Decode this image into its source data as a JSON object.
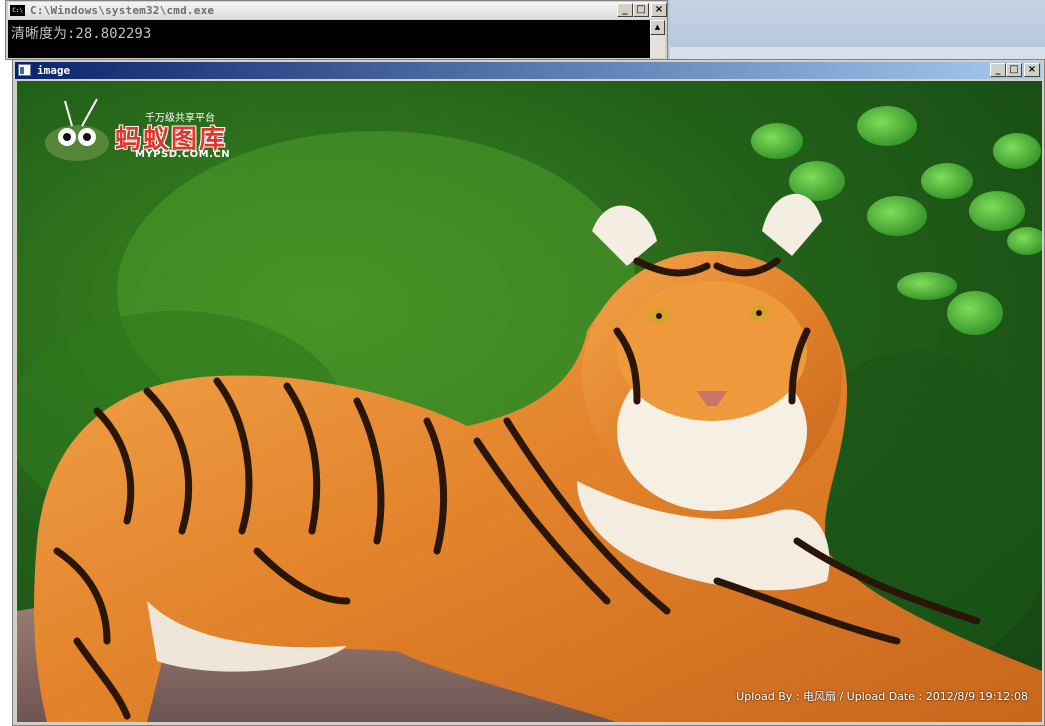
{
  "cmd_window": {
    "title": "C:\\Windows\\system32\\cmd.exe",
    "console_line": "清晰度为:28.802293",
    "buttons": {
      "minimize": "_",
      "maximize": "□",
      "close": "×"
    }
  },
  "image_window": {
    "title": "image",
    "buttons": {
      "minimize": "_",
      "maximize": "□",
      "close": "×"
    }
  },
  "photo": {
    "logo": {
      "name": "蚂蚁图库",
      "tagline": "千万级共享平台",
      "domain": "MYPSD.COM.CN"
    },
    "caption": "Upload By : 电风扇 / Upload Date : 2012/8/9 19:12:08"
  },
  "colors": {
    "console_bg": "#000000",
    "console_text": "#c0c0c0",
    "titlebar_active": "#0a246a",
    "logo_red": "#e0362e"
  },
  "icons": [
    "console-app-icon",
    "image-app-icon",
    "scroll-up-arrow-icon",
    "ant-mascot-icon"
  ]
}
